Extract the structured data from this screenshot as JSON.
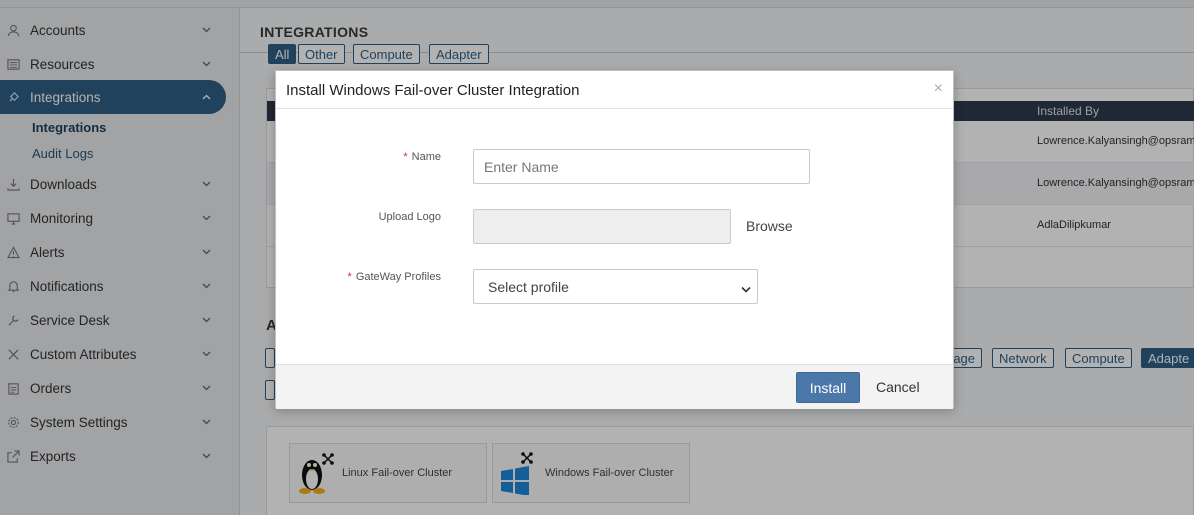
{
  "sidebar": {
    "items": [
      {
        "label": "Accounts",
        "icon": "user-icon"
      },
      {
        "label": "Resources",
        "icon": "list-icon"
      },
      {
        "label": "Integrations",
        "icon": "plug-icon"
      },
      {
        "label": "Downloads",
        "icon": "download-icon"
      },
      {
        "label": "Monitoring",
        "icon": "monitor-icon"
      },
      {
        "label": "Alerts",
        "icon": "alert-icon"
      },
      {
        "label": "Notifications",
        "icon": "bell-icon"
      },
      {
        "label": "Service Desk",
        "icon": "wrench-icon"
      },
      {
        "label": "Custom Attributes",
        "icon": "tools-icon"
      },
      {
        "label": "Orders",
        "icon": "clipboard-icon"
      },
      {
        "label": "System Settings",
        "icon": "gear-icon"
      },
      {
        "label": "Exports",
        "icon": "export-icon"
      }
    ],
    "sub_items": [
      "Integrations",
      "Audit Logs"
    ],
    "active_color": "#2f5f86"
  },
  "main": {
    "title": "INTEGRATIONS",
    "top_filters": [
      "All",
      "Other",
      "Compute",
      "Adapter"
    ],
    "table": {
      "header_installed_by": "Installed By",
      "rows": [
        "Lowrence.Kalyansingh@opsramp",
        "Lowrence.Kalyansingh@opsramp",
        "AdlaDilipkumar"
      ]
    },
    "section_head": "A",
    "bottom_filters": [
      "rage",
      "Network",
      "Compute",
      "Adapte"
    ],
    "cards": [
      "Linux Fail-over Cluster",
      "Windows Fail-over Cluster"
    ]
  },
  "modal": {
    "title": "Install Windows Fail-over Cluster Integration",
    "close": "×",
    "name_label": "Name",
    "name_placeholder": "Enter Name",
    "logo_label": "Upload Logo",
    "browse": "Browse",
    "gateway_label": "GateWay Profiles",
    "gateway_value": "Select profile",
    "required_mark": "*",
    "install": "Install",
    "cancel": "Cancel",
    "install_color": "#4c77a9"
  }
}
